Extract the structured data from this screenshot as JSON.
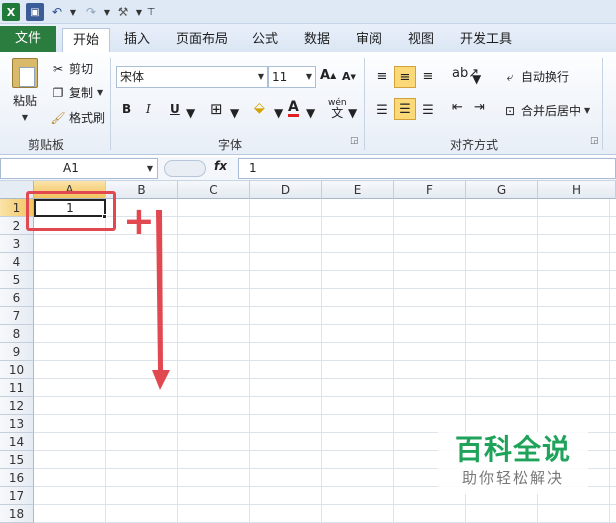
{
  "qat": {
    "excel_icon": "X",
    "undo_icon": "↶",
    "redo_icon": "↷",
    "tools_icon": "⚒"
  },
  "tabs": [
    {
      "label": "文件"
    },
    {
      "label": "开始"
    },
    {
      "label": "插入"
    },
    {
      "label": "页面布局"
    },
    {
      "label": "公式"
    },
    {
      "label": "数据"
    },
    {
      "label": "审阅"
    },
    {
      "label": "视图"
    },
    {
      "label": "开发工具"
    }
  ],
  "clipboard": {
    "paste": "粘贴",
    "cut": "剪切",
    "copy": "复制",
    "format_painter": "格式刷",
    "group": "剪贴板"
  },
  "font": {
    "name": "宋体",
    "size": "11",
    "group": "字体",
    "bold": "B",
    "italic": "I",
    "underline": "U"
  },
  "alignment": {
    "wrap": "自动换行",
    "merge": "合并后居中",
    "group": "对齐方式"
  },
  "formula_bar": {
    "name_box": "A1",
    "fx": "fx",
    "value": "1"
  },
  "grid": {
    "columns": [
      "A",
      "B",
      "C",
      "D",
      "E",
      "F",
      "G",
      "H"
    ],
    "rows": [
      "1",
      "2",
      "3",
      "4",
      "5",
      "6",
      "7",
      "8",
      "9",
      "10",
      "11",
      "12",
      "13",
      "14",
      "15",
      "16",
      "17",
      "18"
    ],
    "a1_value": "1"
  },
  "annotation": {
    "plus": "+",
    "color": "#e2484f"
  },
  "watermark": {
    "title": "百科全说",
    "subtitle": "助你轻松解决"
  }
}
